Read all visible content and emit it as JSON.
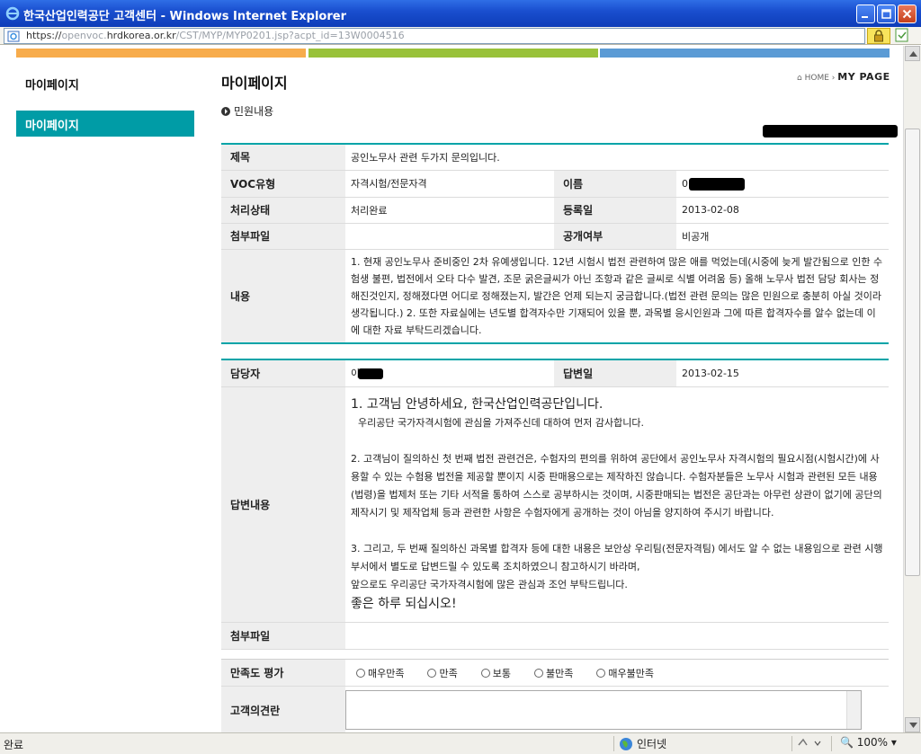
{
  "window": {
    "title": "한국산업인력공단 고객센터 - Windows Internet Explorer"
  },
  "address": {
    "url_prefix": "https://",
    "url_dim1": "openvoc.",
    "url_host": "hrdkorea.or.kr",
    "url_path": "/CST/MYP/MYP0201.jsp?acpt_id=13W0004516"
  },
  "sidebar": {
    "title": "마이페이지",
    "active_item": "마이페이지"
  },
  "page": {
    "title": "마이페이지",
    "breadcrumb_home": "HOME",
    "breadcrumb_current": "MY PAGE",
    "section": "민원내용"
  },
  "complaint": {
    "subject_label": "제목",
    "subject": "공인노무사 관련 두가지 문의입니다.",
    "voc_type_label": "VOC유형",
    "voc_type": "자격시험/전문자격",
    "name_label": "이름",
    "name": "0",
    "status_label": "처리상태",
    "status": "처리완료",
    "reg_date_label": "등록일",
    "reg_date": "2013-02-08",
    "attachment_label": "첨부파일",
    "attachment": "",
    "public_label": "공개여부",
    "public": "비공개",
    "content_label": "내용",
    "content": "1. 현재 공인노무사 준비중인 2차 유예생입니다. 12년 시험시 법전 관련하여 많은 애를 먹었는데(시중에 늦게 발간됨으로 인한 수험생 불편, 법전에서 오타 다수 발견, 조문 굵은글씨가 아닌 조항과 같은 글씨로 식별 어려움 등) 올해 노무사 법전 담당 회사는 정해진것인지, 정해졌다면 어디로 정해졌는지, 발간은 언제 되는지 궁금합니다.(법전 관련 문의는 많은 민원으로 충분히 아실 것이라 생각됩니다.) 2. 또한 자료실에는 년도별 합격자수만 기재되어 있을 뿐, 과목별 응시인원과 그에 따른 합격자수를 알수 없는데 이에 대한 자료 부탁드리겠습니다."
  },
  "answer": {
    "manager_label": "담당자",
    "manager": "이",
    "answer_date_label": "답변일",
    "answer_date": "2013-02-15",
    "content_label": "답변내용",
    "greeting": "1. 고객님 안녕하세요, 한국산업인력공단입니다.",
    "thanks": "우리공단 국가자격시험에 관심을 가져주신데 대하여 먼저 감사합니다.",
    "para2": "2. 고객님이 질의하신 첫 번째 법전 관련건은, 수험자의 편의를 위하여 공단에서 공인노무사 자격시험의 필요시점(시험시간)에 사용할 수 있는 수험용 법전을 제공할 뿐이지 시중 판매용으로는 제작하진 않습니다. 수험자분들은 노무사 시험과 관련된 모든 내용(법령)을 법제처 또는 기타 서적을 통하여 스스로 공부하시는 것이며, 시중판매되는 법전은 공단과는 아무런 상관이 없기에 공단의 제작시기 및 제작업체 등과 관련한 사항은 수험자에게 공개하는 것이 아님을 양지하여 주시기 바랍니다.",
    "para3": "3. 그리고, 두 번째 질의하신 과목별 합격자 등에 대한 내용은 보안상 우리팀(전문자격팀) 에서도 알 수 없는 내용임으로 관련 시행부서에서 별도로 답변드릴 수 있도록 조치하였으니 참고하시기 바라며,",
    "para4": "앞으로도 우리공단 국가자격시험에 많은 관심과 조언 부탁드립니다.",
    "closing": "좋은 하루 되십시오!",
    "attachment_label": "첨부파일",
    "attachment": ""
  },
  "rating": {
    "label": "만족도 평가",
    "options": [
      "매우만족",
      "만족",
      "보통",
      "불만족",
      "매우불만족"
    ],
    "opinion_label": "고객의견란",
    "opinion": ""
  },
  "statusbar": {
    "status": "완료",
    "zone": "인터넷",
    "zoom": "100%"
  },
  "colors": {
    "accent_teal": "#009ca6",
    "stripe_orange": "#f7ac4c",
    "stripe_green": "#99c23a",
    "stripe_blue": "#5b9bd5"
  }
}
